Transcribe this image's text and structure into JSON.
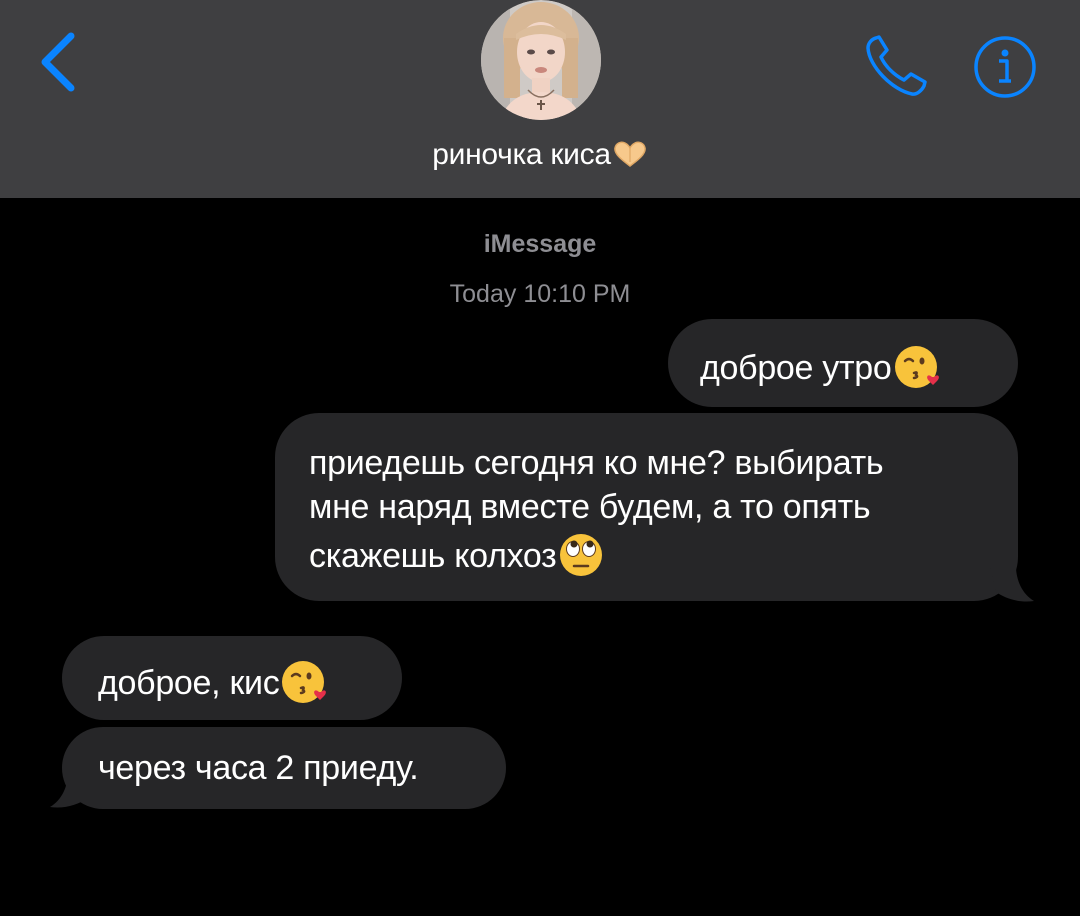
{
  "header": {
    "contact_name": "риночка киса",
    "contact_emoji": "heart-hands-emoji",
    "back_icon": "chevron-left-icon",
    "call_icon": "phone-icon",
    "info_icon": "info-icon",
    "accent_color": "#0a84ff",
    "background_color": "#3f3f41"
  },
  "conversation": {
    "service": "iMessage",
    "timestamp": "Today 10:10 PM"
  },
  "messages": [
    {
      "direction": "outgoing",
      "text": "доброе утро",
      "emoji": "kissing-heart-emoji"
    },
    {
      "direction": "outgoing",
      "lines": [
        "приедешь сегодня ко мне? выбирать",
        "мне наряд вместе будем, а то опять",
        "скажешь колхоз"
      ],
      "emoji": "eye-roll-emoji"
    },
    {
      "direction": "incoming",
      "text": "доброе, кис",
      "emoji": "kissing-heart-emoji"
    },
    {
      "direction": "incoming",
      "text": "через часа 2 приеду."
    }
  ],
  "colors": {
    "bubble": "#262628",
    "background": "#000000",
    "secondary_text": "#8e8e93"
  }
}
